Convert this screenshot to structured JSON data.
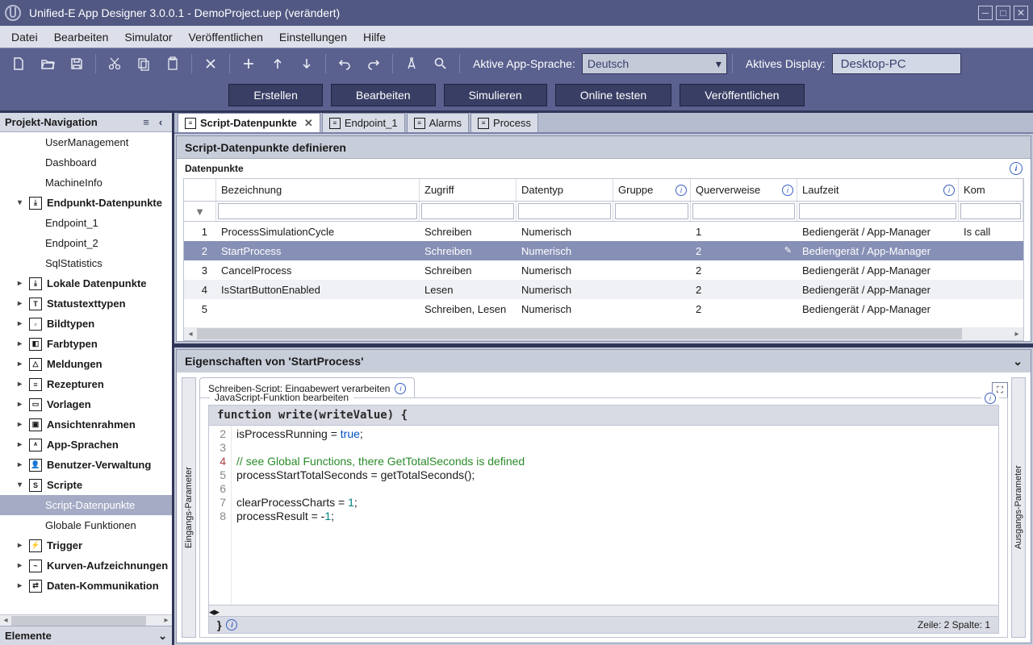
{
  "titlebar": {
    "text": "Unified-E App Designer 3.0.0.1 - DemoProject.uep  (verändert)"
  },
  "menu": [
    "Datei",
    "Bearbeiten",
    "Simulator",
    "Veröffentlichen",
    "Einstellungen",
    "Hilfe"
  ],
  "toolbar": {
    "lang_label": "Aktive App-Sprache:",
    "lang_value": "Deutsch",
    "display_label": "Aktives Display:",
    "display_value": "Desktop-PC"
  },
  "actions": [
    "Erstellen",
    "Bearbeiten",
    "Simulieren",
    "Online testen",
    "Veröffentlichen"
  ],
  "sidebar": {
    "nav_title": "Projekt-Navigation",
    "elements_title": "Elemente",
    "items": [
      {
        "label": "UserManagement",
        "depth": 2,
        "bold": false
      },
      {
        "label": "Dashboard",
        "depth": 2,
        "bold": false
      },
      {
        "label": "MachineInfo",
        "depth": 2,
        "bold": false
      },
      {
        "label": "Endpunkt-Datenpunkte",
        "depth": 1,
        "bold": true,
        "exp": "▾",
        "icon": "⤓"
      },
      {
        "label": "Endpoint_1",
        "depth": 2,
        "bold": false
      },
      {
        "label": "Endpoint_2",
        "depth": 2,
        "bold": false
      },
      {
        "label": "SqlStatistics",
        "depth": 2,
        "bold": false
      },
      {
        "label": "Lokale Datenpunkte",
        "depth": 1,
        "bold": true,
        "exp": "▸",
        "icon": "⤓"
      },
      {
        "label": "Statustexttypen",
        "depth": 1,
        "bold": true,
        "exp": "▸",
        "icon": "T"
      },
      {
        "label": "Bildtypen",
        "depth": 1,
        "bold": true,
        "exp": "▸",
        "icon": "▫"
      },
      {
        "label": "Farbtypen",
        "depth": 1,
        "bold": true,
        "exp": "▸",
        "icon": "◧"
      },
      {
        "label": "Meldungen",
        "depth": 1,
        "bold": true,
        "exp": "▸",
        "icon": "△"
      },
      {
        "label": "Rezepturen",
        "depth": 1,
        "bold": true,
        "exp": "▸",
        "icon": "≡"
      },
      {
        "label": "Vorlagen",
        "depth": 1,
        "bold": true,
        "exp": "▸",
        "icon": "▭"
      },
      {
        "label": "Ansichtenrahmen",
        "depth": 1,
        "bold": true,
        "exp": "▸",
        "icon": "▣"
      },
      {
        "label": "App-Sprachen",
        "depth": 1,
        "bold": true,
        "exp": "▸",
        "icon": "ᴬ"
      },
      {
        "label": "Benutzer-Verwaltung",
        "depth": 1,
        "bold": true,
        "exp": "▸",
        "icon": "👤"
      },
      {
        "label": "Scripte",
        "depth": 1,
        "bold": true,
        "exp": "▾",
        "icon": "S"
      },
      {
        "label": "Script-Datenpunkte",
        "depth": 2,
        "bold": false,
        "sel": true
      },
      {
        "label": "Globale Funktionen",
        "depth": 2,
        "bold": false
      },
      {
        "label": "Trigger",
        "depth": 1,
        "bold": true,
        "exp": "▸",
        "icon": "⚡"
      },
      {
        "label": "Kurven-Aufzeichnungen",
        "depth": 1,
        "bold": true,
        "exp": "▸",
        "icon": "~"
      },
      {
        "label": "Daten-Kommunikation",
        "depth": 1,
        "bold": true,
        "exp": "▸",
        "icon": "⇄"
      }
    ]
  },
  "tabs": [
    {
      "label": "Script-Datenpunkte",
      "active": true,
      "close": true
    },
    {
      "label": "Endpoint_1",
      "active": false
    },
    {
      "label": "Alarms",
      "active": false
    },
    {
      "label": "Process",
      "active": false
    }
  ],
  "editor": {
    "title": "Script-Datenpunkte definieren",
    "subtitle": "Datenpunkte",
    "columns": [
      "",
      "Bezeichnung",
      "Zugriff",
      "Datentyp",
      "Gruppe",
      "Querverweise",
      "Laufzeit",
      "Kom"
    ],
    "rows": [
      {
        "n": "1",
        "name": "ProcessSimulationCycle",
        "access": "Schreiben",
        "type": "Numerisch",
        "group": "",
        "xref": "1",
        "runtime": "Bediengerät / App-Manager",
        "comment": "Is call"
      },
      {
        "n": "2",
        "name": "StartProcess",
        "access": "Schreiben",
        "type": "Numerisch",
        "group": "",
        "xref": "2",
        "runtime": "Bediengerät / App-Manager",
        "comment": "",
        "sel": true
      },
      {
        "n": "3",
        "name": "CancelProcess",
        "access": "Schreiben",
        "type": "Numerisch",
        "group": "",
        "xref": "2",
        "runtime": "Bediengerät / App-Manager",
        "comment": ""
      },
      {
        "n": "4",
        "name": "IsStartButtonEnabled",
        "access": "Lesen",
        "type": "Numerisch",
        "group": "",
        "xref": "2",
        "runtime": "Bediengerät / App-Manager",
        "comment": ""
      },
      {
        "n": "5",
        "name": "",
        "access": "Schreiben, Lesen",
        "type": "Numerisch",
        "group": "",
        "xref": "2",
        "runtime": "Bediengerät / App-Manager",
        "comment": ""
      }
    ]
  },
  "props": {
    "title": "Eigenschaften von 'StartProcess'",
    "tab_label": "Schreiben-Script: Eingabewert verarbeiten",
    "left_tab": "Eingangs-Parameter",
    "right_tab": "Ausgangs-Parameter",
    "fieldset_label": "JavaScript-Funktion bearbeiten",
    "signature": "function write(writeValue) {",
    "close_brace": "}",
    "status": "Zeile: 2  Spalte: 1",
    "gutter": [
      "2",
      "3",
      "4",
      "5",
      "6",
      "7",
      "8"
    ],
    "code_lines": [
      {
        "t": "isProcessRunning = ",
        "bool": "true",
        "t2": ";"
      },
      {
        "t": ""
      },
      {
        "comment": "// see Global Functions, there GetTotalSeconds is defined"
      },
      {
        "t": "processStartTotalSeconds = getTotalSeconds();"
      },
      {
        "t": ""
      },
      {
        "t": "clearProcessCharts = ",
        "num": "1",
        "t2": ";"
      },
      {
        "t": "processResult = -",
        "num": "1",
        "t2": ";"
      }
    ]
  }
}
